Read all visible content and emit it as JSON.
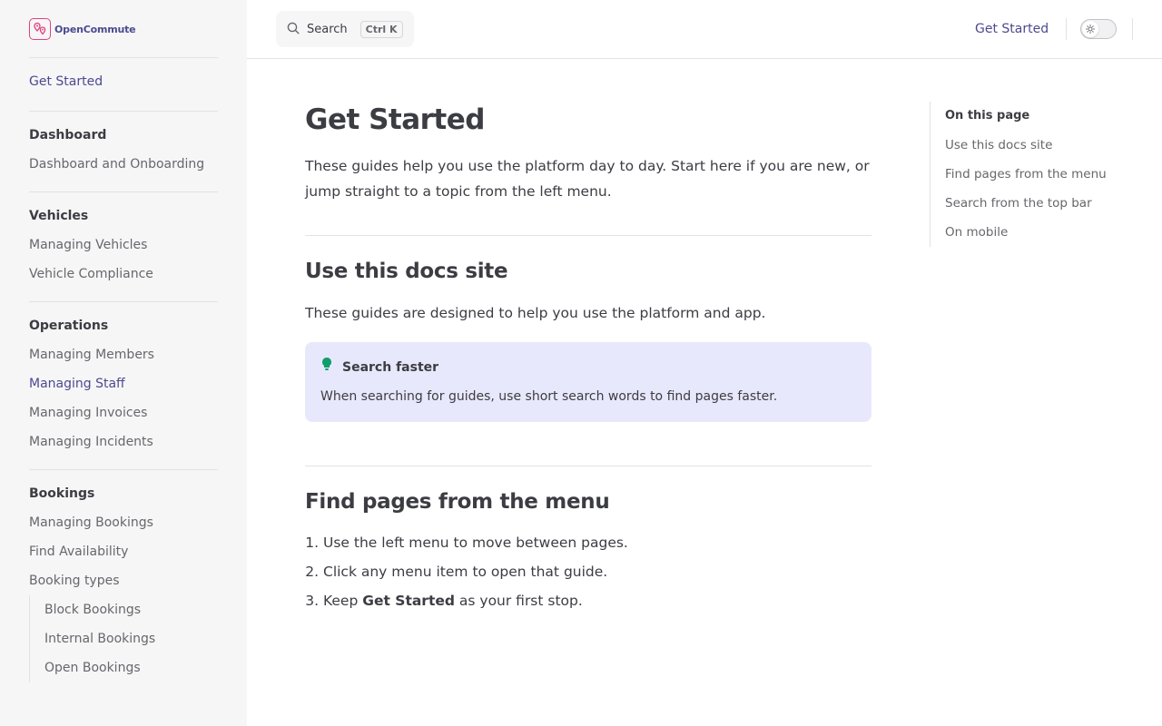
{
  "brand": {
    "name": "OpenCommute",
    "accent": "#e3407d",
    "primary": "#4b4a8f"
  },
  "sidebar": {
    "top_item": "Get Started",
    "groups": [
      {
        "title": "Dashboard",
        "items": [
          "Dashboard and Onboarding"
        ]
      },
      {
        "title": "Vehicles",
        "items": [
          "Managing Vehicles",
          "Vehicle Compliance"
        ]
      },
      {
        "title": "Operations",
        "items": [
          "Managing Members",
          "Managing Staff",
          "Managing Invoices",
          "Managing Incidents"
        ]
      },
      {
        "title": "Bookings",
        "items": [
          "Managing Bookings",
          "Find Availability",
          "Booking types"
        ],
        "sub_items": [
          "Block Bookings",
          "Internal Bookings",
          "Open Bookings"
        ]
      }
    ]
  },
  "topbar": {
    "search_label": "Search",
    "search_shortcut": "Ctrl K",
    "link": "Get Started"
  },
  "main": {
    "title": "Get Started",
    "intro": "These guides help you use the platform day to day. Start here if you are new, or jump straight to a topic from the left menu.",
    "section1_title": "Use this docs site",
    "section1_text": "These guides are designed to help you use the platform and app.",
    "tip_title": "Search faster",
    "tip_body": "When searching for guides, use short search words to find pages faster.",
    "section2_title": "Find pages from the menu",
    "steps": [
      "Use the left menu to move between pages.",
      "Click any menu item to open that guide."
    ],
    "step3_pre": "Keep ",
    "step3_bold": "Get Started",
    "step3_post": " as your first stop."
  },
  "outline": {
    "title": "On this page",
    "items": [
      "Use this docs site",
      "Find pages from the menu",
      "Search from the top bar",
      "On mobile"
    ]
  }
}
